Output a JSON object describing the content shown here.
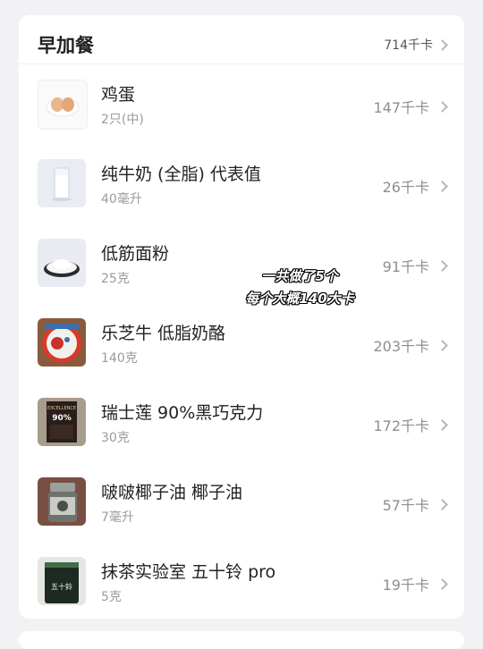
{
  "meal": {
    "title": "早加餐",
    "total": "714千卡"
  },
  "items": [
    {
      "name": "鸡蛋",
      "amount": "2只(中)",
      "kcal": "147千卡",
      "icon": "egg-photo"
    },
    {
      "name": "纯牛奶 (全脂) 代表值",
      "amount": "40毫升",
      "kcal": "26千卡",
      "icon": "milk-photo"
    },
    {
      "name": "低筋面粉",
      "amount": "25克",
      "kcal": "91千卡",
      "icon": "flour-photo"
    },
    {
      "name": "乐芝牛 低脂奶酪",
      "amount": "140克",
      "kcal": "203千卡",
      "icon": "cheese-photo"
    },
    {
      "name": "瑞士莲 90%黑巧克力",
      "amount": "30克",
      "kcal": "172千卡",
      "icon": "chocolate-photo"
    },
    {
      "name": "啵啵椰子油 椰子油",
      "amount": "7毫升",
      "kcal": "57千卡",
      "icon": "coconut-oil-photo"
    },
    {
      "name": "抹茶实验室 五十铃 pro",
      "amount": "5克",
      "kcal": "19千卡",
      "icon": "matcha-photo"
    }
  ],
  "annotation": {
    "line1": "一共做了5个",
    "line2": "每个大概140大卡"
  },
  "product_text": {
    "chocolate_brand": "EXCELLENCE",
    "chocolate_percent": "90%",
    "matcha_label": "五十鈴"
  }
}
